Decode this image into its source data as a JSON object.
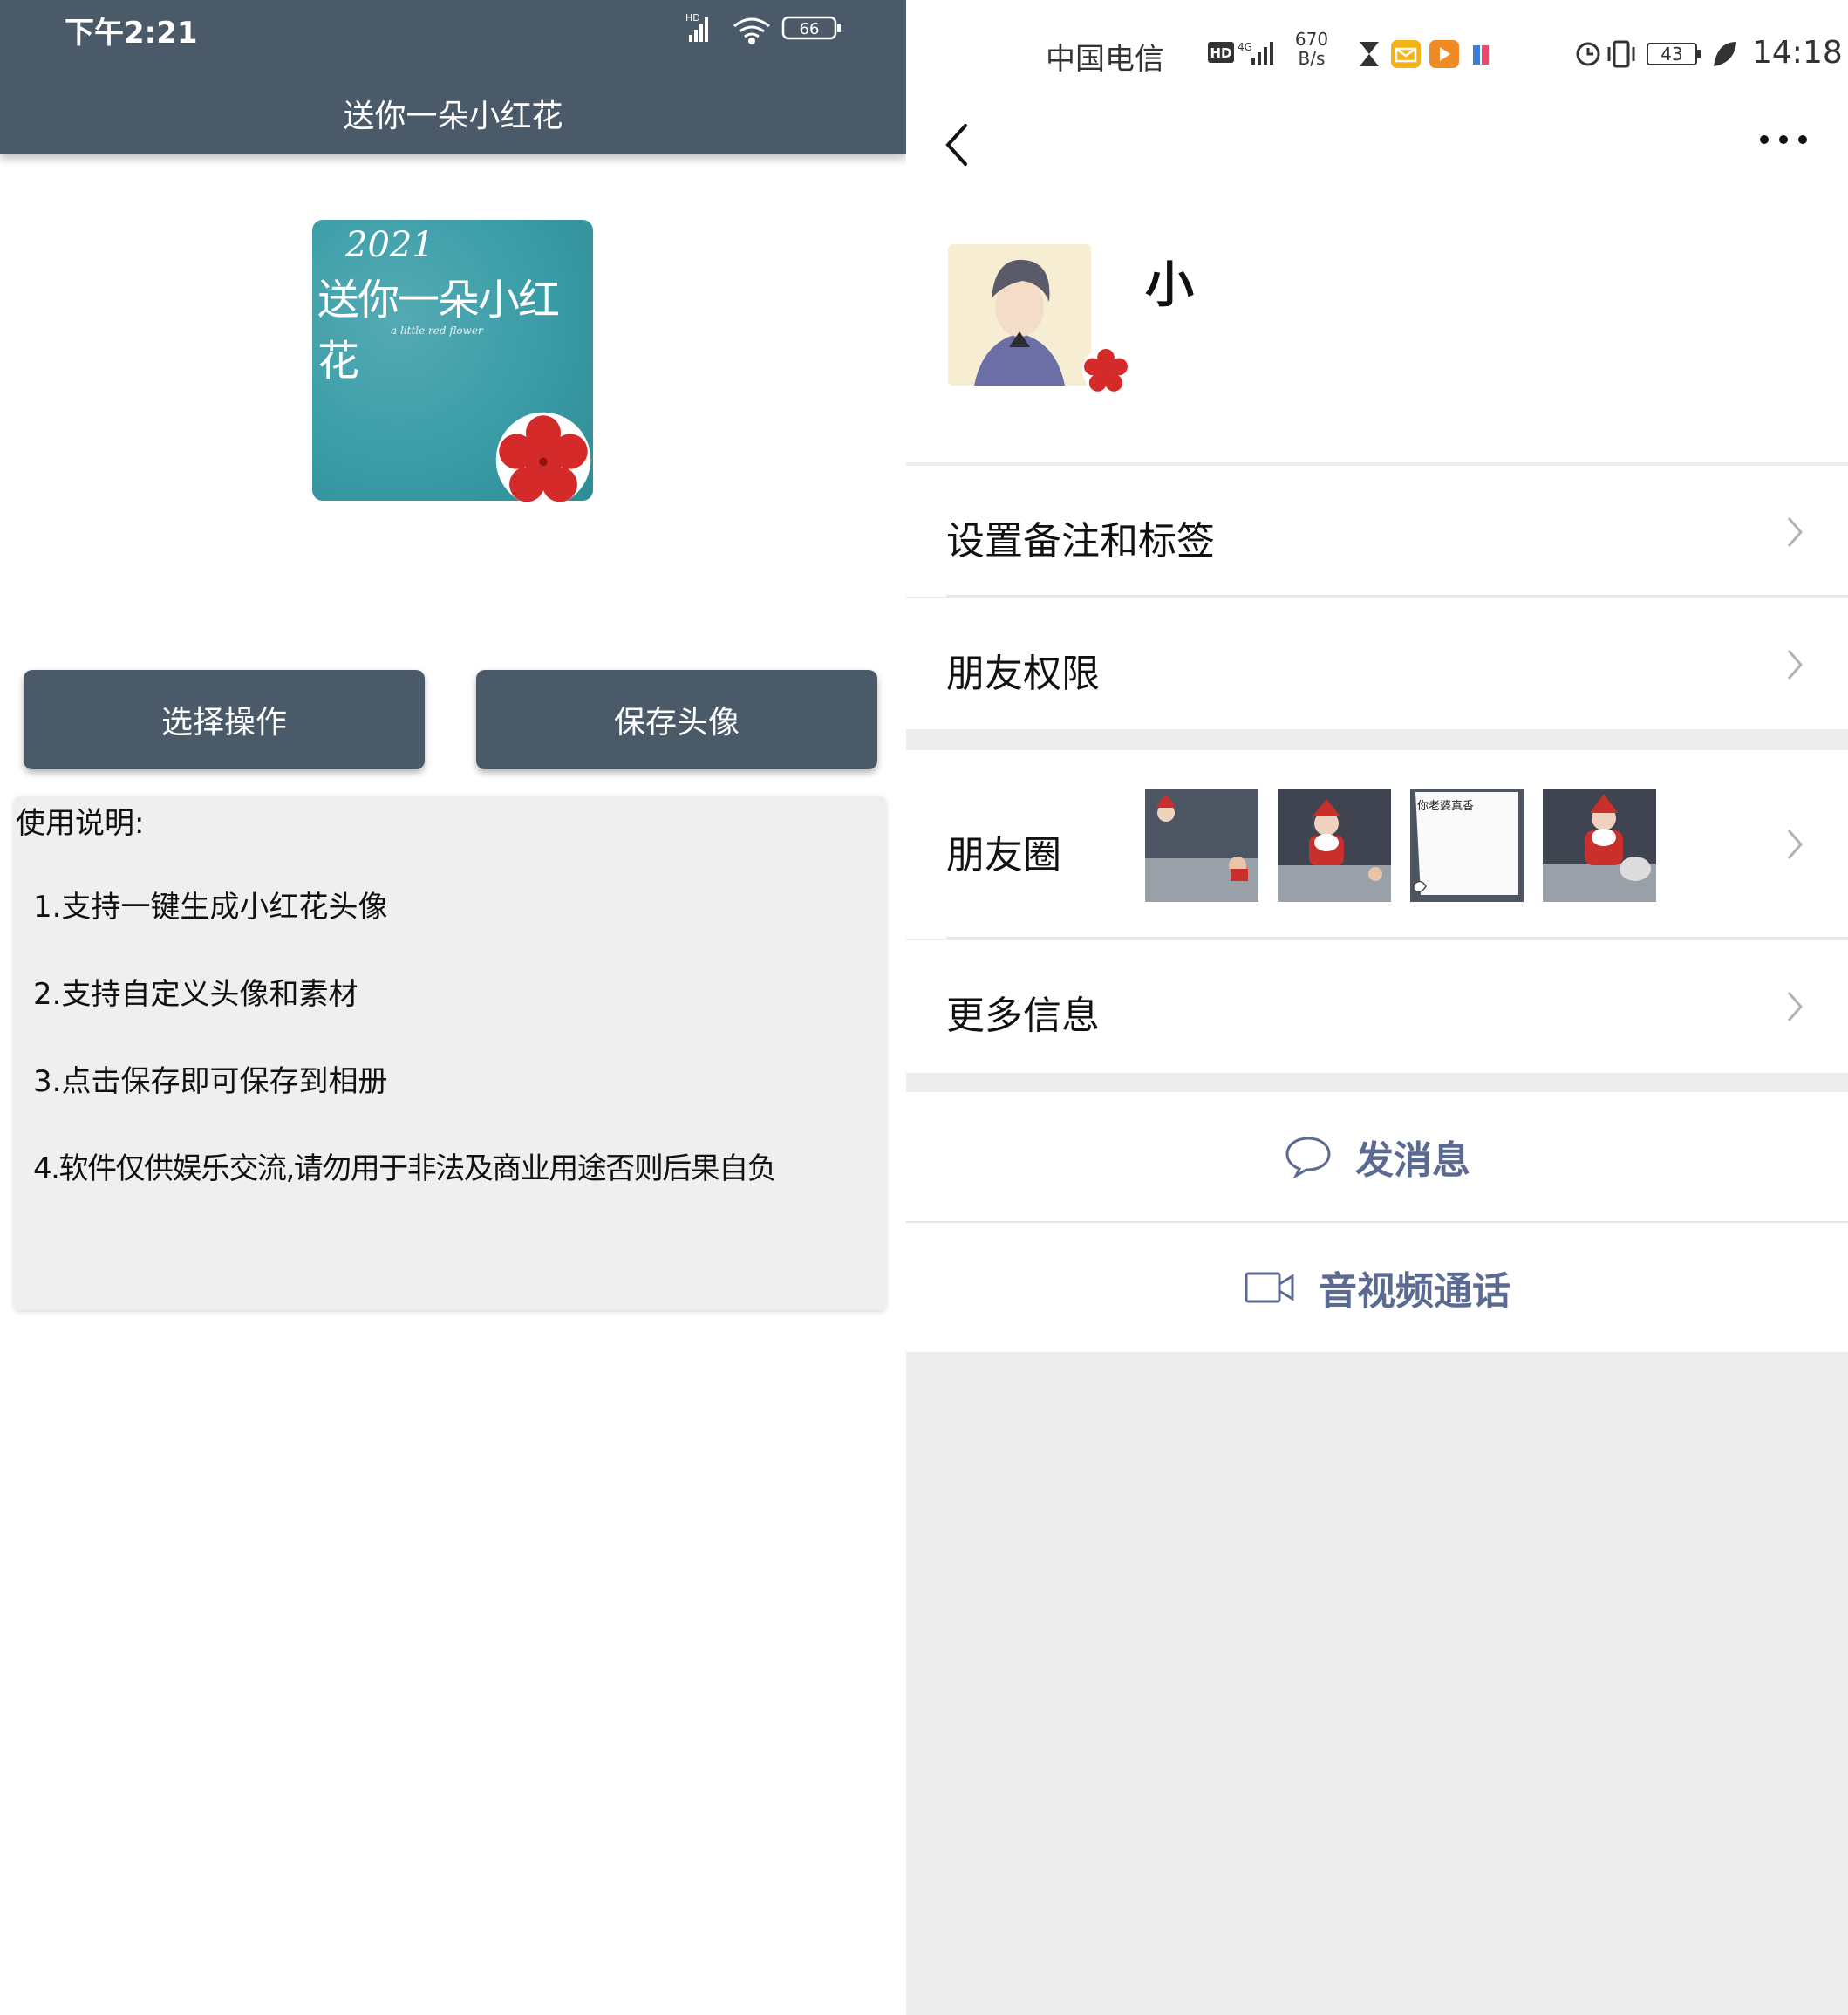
{
  "left": {
    "status_time": "下午2:21",
    "battery": "66",
    "title": "送你一朵小红花",
    "avatar": {
      "year": "2021",
      "text": "送你一朵小红花",
      "subtitle": "a little red flower"
    },
    "buttons": {
      "select": "选择操作",
      "save": "保存头像"
    },
    "instructions": {
      "title": "使用说明:",
      "items": [
        "1.支持一键生成小红花头像",
        "2.支持自定义头像和素材",
        "3.点击保存即可保存到相册",
        "4.软件仅供娱乐交流,请勿用于非法及商业用途否则后果自负"
      ]
    },
    "colors": {
      "bar": "#4b5a68",
      "avatar_bg": "#3b9ea8",
      "flower": "#d42a2a"
    }
  },
  "right": {
    "status": {
      "carrier": "中国电信",
      "hd": "HD",
      "network": "4G",
      "speed_value": "670",
      "speed_unit": "B/s",
      "battery": "43",
      "time": "14:18"
    },
    "contact_name": "小",
    "rows": {
      "remark": "设置备注和标签",
      "permissions": "朋友权限",
      "moments": "朋友圈",
      "more_info": "更多信息"
    },
    "moments_thumbs": [
      {
        "icon": "santa-thumbnail-1"
      },
      {
        "icon": "santa-thumbnail-2"
      },
      {
        "icon": "paper-note-thumbnail",
        "text": "你老婆真香"
      },
      {
        "icon": "santa-thumbnail-4"
      }
    ],
    "actions": {
      "message": "发消息",
      "call": "音视频通话"
    },
    "colors": {
      "action_text": "#5b6a91",
      "background": "#ededed"
    }
  }
}
